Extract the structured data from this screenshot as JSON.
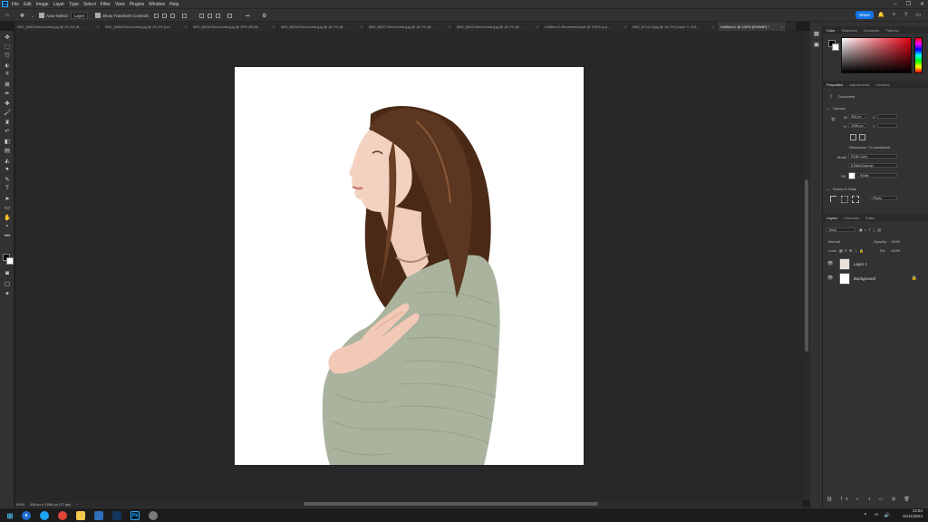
{
  "menubar": {
    "logo": "Ps",
    "items": [
      "File",
      "Edit",
      "Image",
      "Layer",
      "Type",
      "Select",
      "Filter",
      "View",
      "Plugins",
      "Window",
      "Help"
    ]
  },
  "options": {
    "auto_select_label": "Auto-Select:",
    "auto_select_value": "Layer",
    "transform_label": "Show Transform Controls",
    "more": "•••",
    "share": "Share"
  },
  "tabs": [
    {
      "label": "IMG_8483-Recovered.jpg @ 13.2% (B...",
      "active": false
    },
    {
      "label": "IMG_8485-Recovered.jpg @ 13.2% (La...",
      "active": false
    },
    {
      "label": "IMG_8526-Recovered.jpg @ 25% (RGB...",
      "active": false
    },
    {
      "label": "IMG_8534-Recovered.jpg @ 16.7% (B...",
      "active": false
    },
    {
      "label": "IMG_8537-Recovered.jpg @ 16.7% (B...",
      "active": false
    },
    {
      "label": "IMG_8542-Recovered.jpg @ 16.7% (B...",
      "active": false
    },
    {
      "label": "Untitled-2-Recovered.psd @ 100% (La...",
      "active": false
    },
    {
      "label": "IMG_8714-2.jpg @ 16.7% (Layer 1, RG...",
      "active": false
    },
    {
      "label": "Untitled-1 @ 100% (RGB/8*) *",
      "active": true
    }
  ],
  "status": {
    "zoom": "100%",
    "size": "905 px x 1098 px (72 ppi)"
  },
  "color_panel": {
    "tabs": [
      "Color",
      "Swatches",
      "Gradients",
      "Patterns"
    ]
  },
  "properties": {
    "tabs": [
      "Properties",
      "Adjustments",
      "Libraries"
    ],
    "doc_label": "Document",
    "canvas_title": "Canvas",
    "w_label": "W",
    "w_value": "905 px",
    "h_label": "H",
    "h_value": "1098 px",
    "x_label": "X",
    "y_label": "Y",
    "resolution": "Resolution: 72 pixels/inch",
    "mode_label": "Mode",
    "mode_value": "RGB Color",
    "depth_value": "8 Bits/Channel",
    "fill_label": "Fill",
    "fill_value": "White",
    "rulers_title": "Rulers & Grids",
    "units_value": "Pixels"
  },
  "layers": {
    "tabs": [
      "Layers",
      "Channels",
      "Paths"
    ],
    "kind": "Kind",
    "blend": "Normal",
    "opacity_label": "Opacity:",
    "opacity_value": "100%",
    "lock_label": "Lock:",
    "fill_label": "Fill:",
    "fill_value": "100%",
    "items": [
      {
        "name": "Layer 1",
        "visible": true
      },
      {
        "name": "Background",
        "visible": true
      }
    ]
  },
  "clock": {
    "time": "14:54",
    "date": "15/11/2024"
  },
  "colors": {
    "accent": "#1473e6",
    "canvas_bg": "#282828",
    "sweater": "#a9b39e",
    "hair": "#5b3620"
  }
}
